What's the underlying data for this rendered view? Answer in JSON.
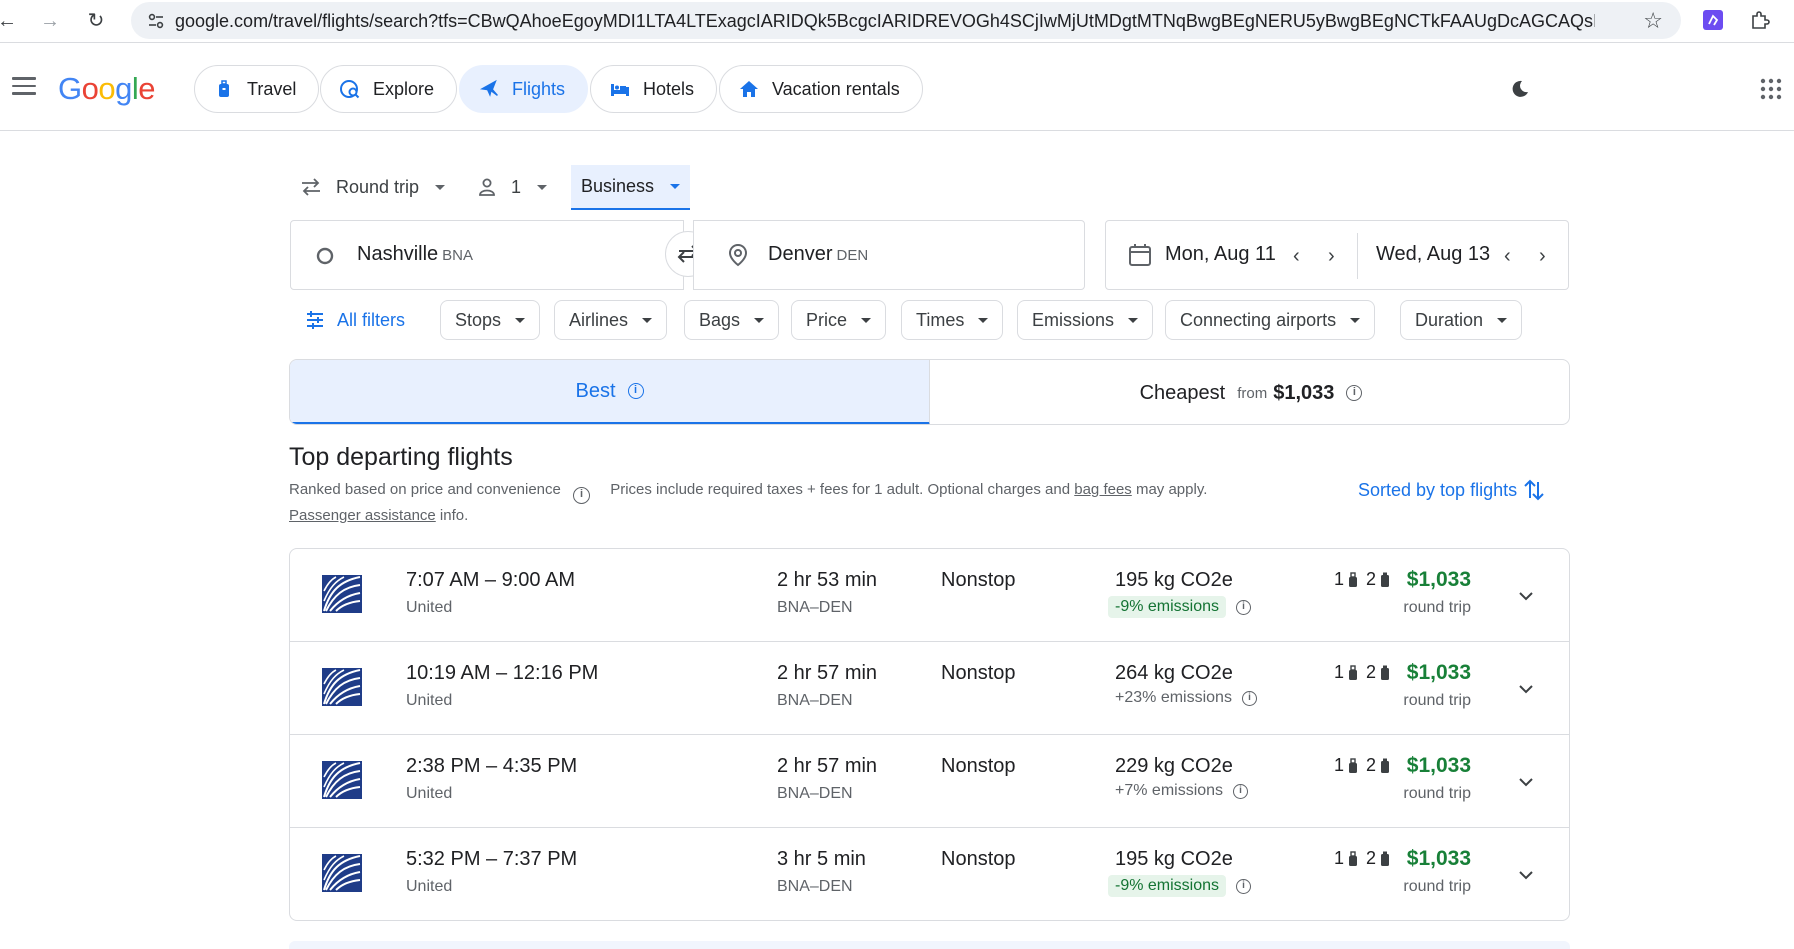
{
  "browser": {
    "url": "google.com/travel/flights/search?tfs=CBwQAhoeEgoyMDI1LTA4LTExagcIARIDQk5BcgcIARIDREVOGh4SCjIwMjUtMDgtMTNqBwgBEgNERU5yBwgBEgNCTkFAAUgDcAGCAQsI__________AZ..."
  },
  "header": {
    "logo": "Google",
    "nav": [
      {
        "label": "Travel"
      },
      {
        "label": "Explore"
      },
      {
        "label": "Flights"
      },
      {
        "label": "Hotels"
      },
      {
        "label": "Vacation rentals"
      }
    ]
  },
  "search": {
    "trip_type": "Round trip",
    "passengers": "1",
    "cabin_class": "Business",
    "origin": {
      "city": "Nashville",
      "code": "BNA"
    },
    "destination": {
      "city": "Denver",
      "code": "DEN"
    },
    "depart_date": "Mon, Aug 11",
    "return_date": "Wed, Aug 13"
  },
  "filters": {
    "all_filters": "All filters",
    "chips": [
      "Stops",
      "Airlines",
      "Bags",
      "Price",
      "Times",
      "Emissions",
      "Connecting airports",
      "Duration"
    ]
  },
  "tabs": {
    "best": "Best",
    "cheapest": "Cheapest",
    "cheapest_from": "from",
    "cheapest_price": "$1,033"
  },
  "results_header": {
    "title": "Top departing flights",
    "ranked": "Ranked based on price and convenience",
    "prices_note_a": "Prices include required taxes + fees for 1 adult. Optional charges and ",
    "bag_fees": "bag fees",
    "prices_note_b": " may apply.",
    "passenger_assistance": "Passenger assistance",
    "info_suffix": " info.",
    "sorted_by": "Sorted by top flights"
  },
  "flights": [
    {
      "times": "7:07 AM – 9:00 AM",
      "airline": "United",
      "duration": "2 hr 53 min",
      "route": "BNA–DEN",
      "stops": "Nonstop",
      "co2": "195 kg CO2e",
      "emissions": "-9% emissions",
      "emissions_good": true,
      "carry_on": "1",
      "checked": "2",
      "price": "$1,033",
      "price_note": "round trip"
    },
    {
      "times": "10:19 AM – 12:16 PM",
      "airline": "United",
      "duration": "2 hr 57 min",
      "route": "BNA–DEN",
      "stops": "Nonstop",
      "co2": "264 kg CO2e",
      "emissions": "+23% emissions",
      "emissions_good": false,
      "carry_on": "1",
      "checked": "2",
      "price": "$1,033",
      "price_note": "round trip"
    },
    {
      "times": "2:38 PM – 4:35 PM",
      "airline": "United",
      "duration": "2 hr 57 min",
      "route": "BNA–DEN",
      "stops": "Nonstop",
      "co2": "229 kg CO2e",
      "emissions": "+7% emissions",
      "emissions_good": false,
      "carry_on": "1",
      "checked": "2",
      "price": "$1,033",
      "price_note": "round trip"
    },
    {
      "times": "5:32 PM – 7:37 PM",
      "airline": "United",
      "duration": "3 hr 5 min",
      "route": "BNA–DEN",
      "stops": "Nonstop",
      "co2": "195 kg CO2e",
      "emissions": "-9% emissions",
      "emissions_good": true,
      "carry_on": "1",
      "checked": "2",
      "price": "$1,033",
      "price_note": "round trip"
    }
  ],
  "colors": {
    "accent": "#1a73e8",
    "price": "#188038",
    "good_emissions_bg": "#e6f4ea",
    "good_emissions_text": "#137333"
  }
}
